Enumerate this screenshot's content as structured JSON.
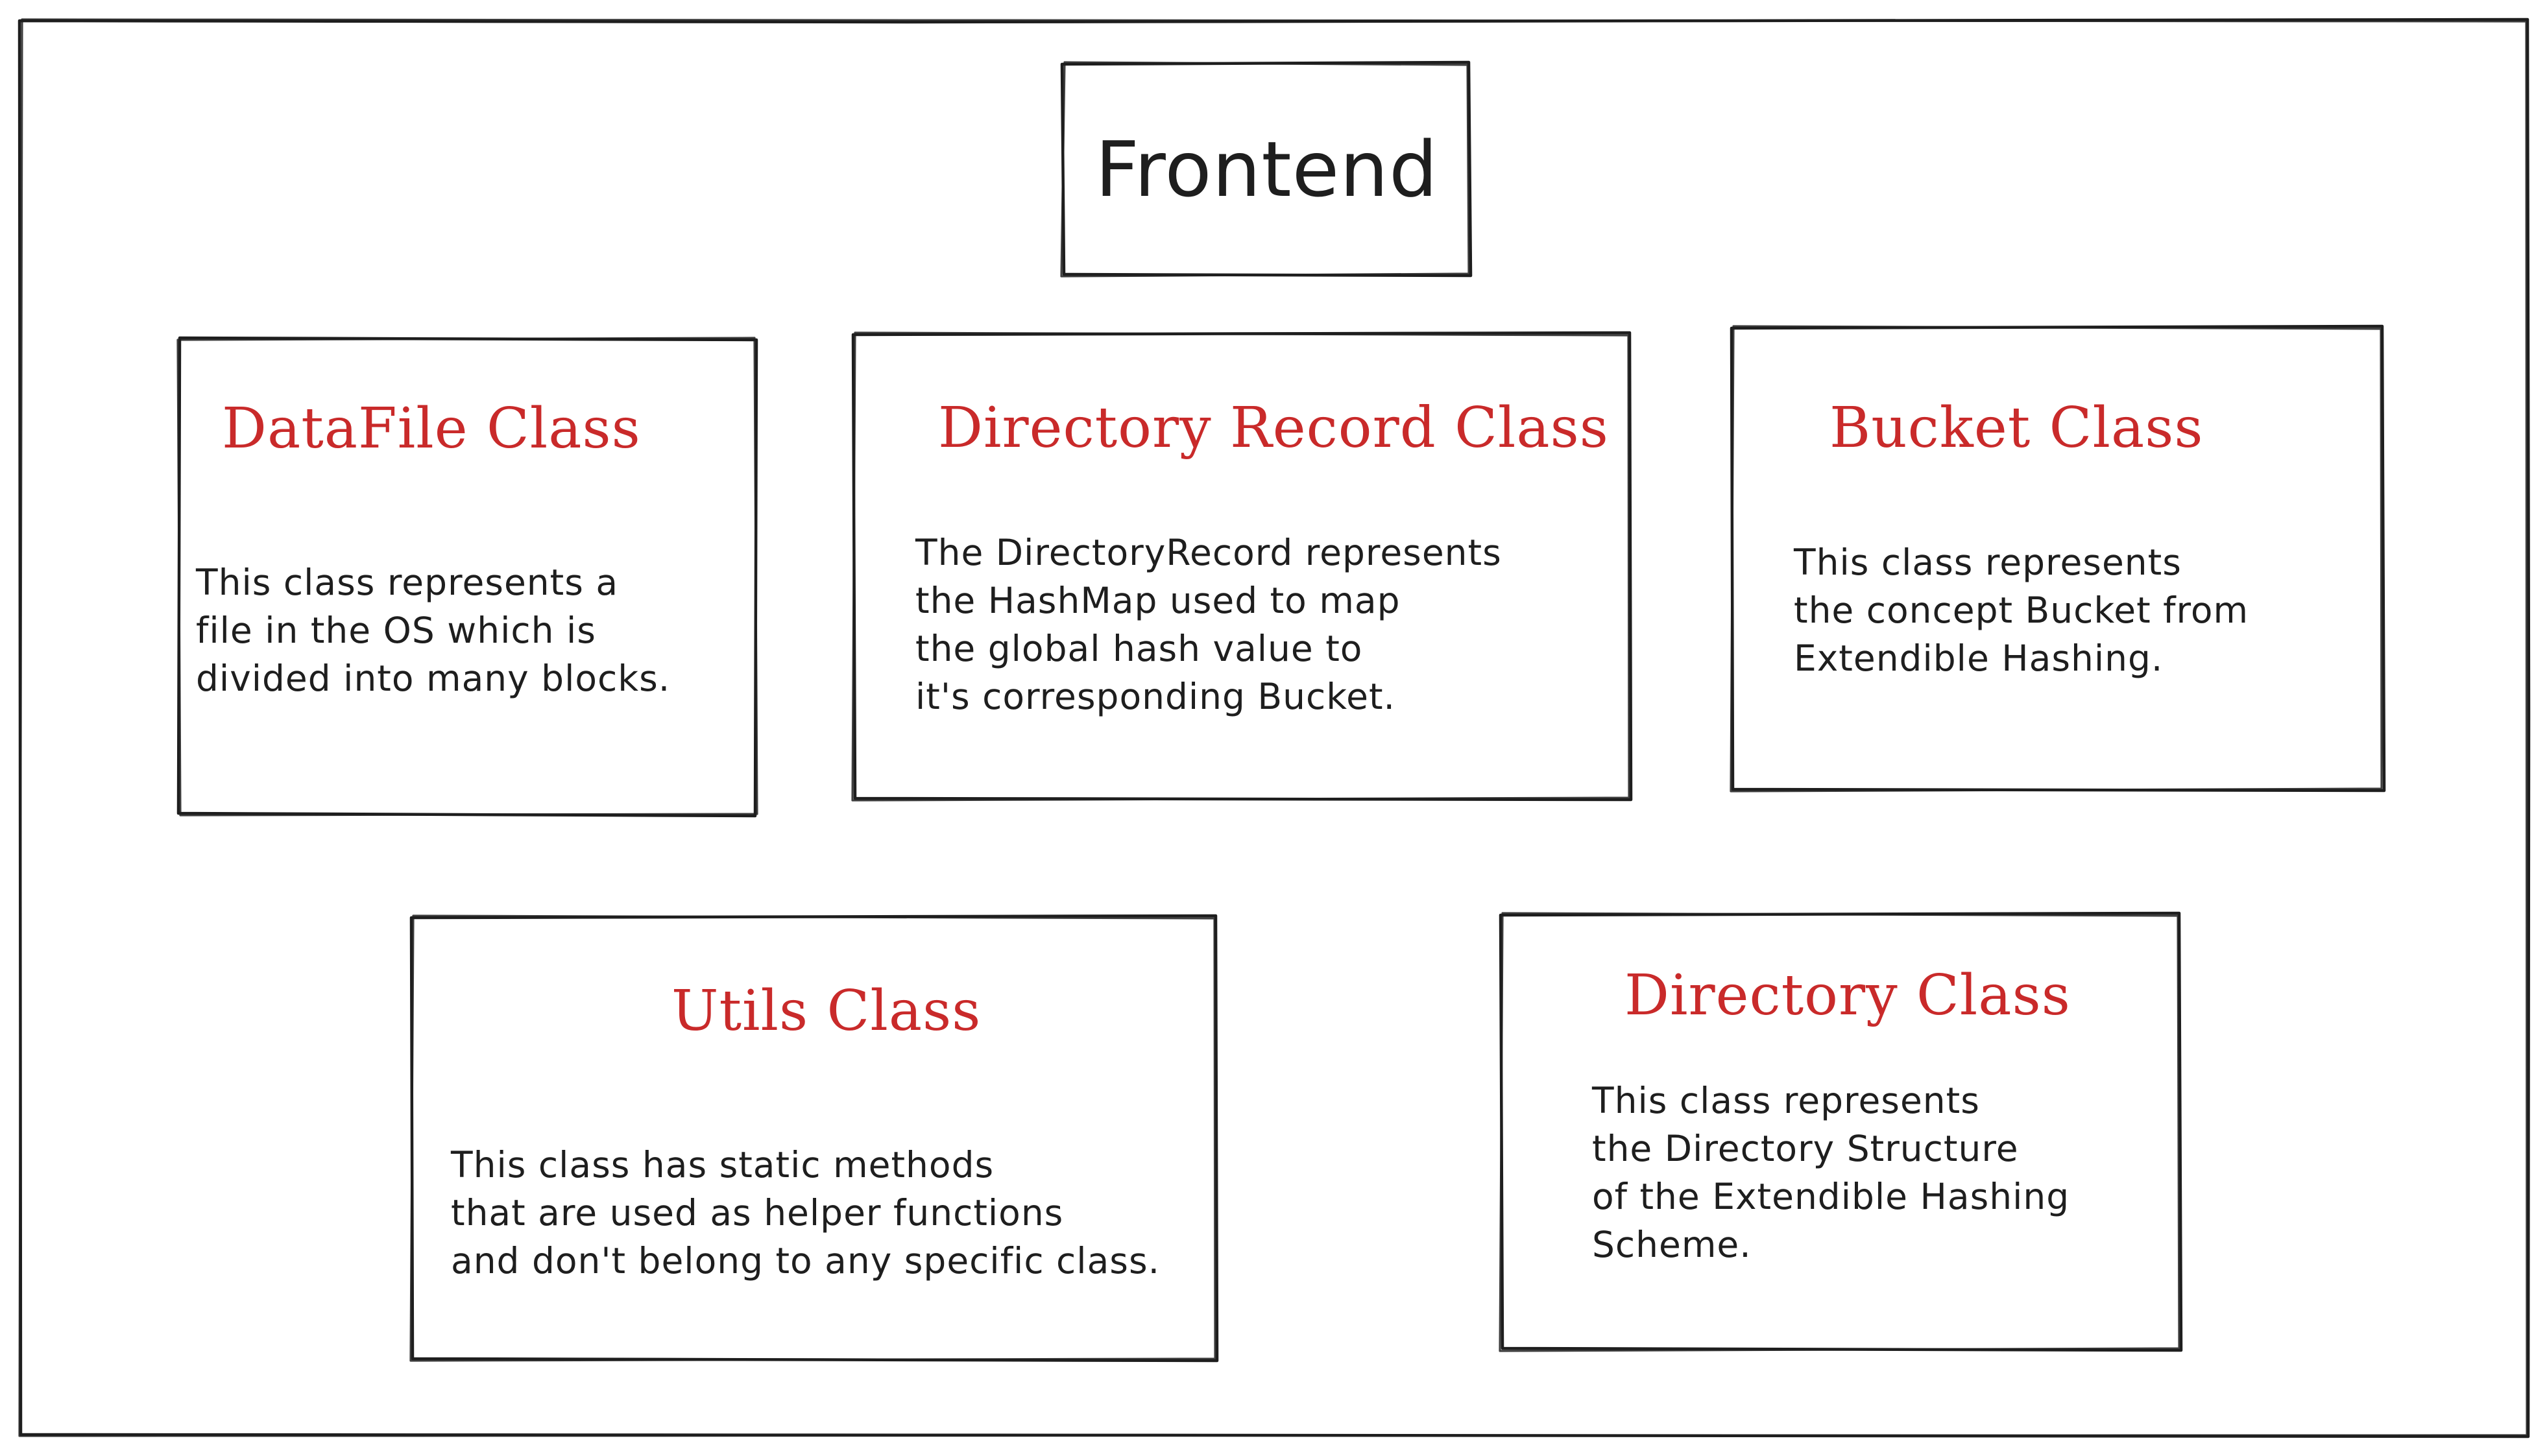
{
  "diagram": {
    "root": {
      "label": "Frontend"
    },
    "classes": [
      {
        "id": "datafile",
        "title": "DataFile Class",
        "description": [
          "This class represents a",
          "file in the OS which is",
          "divided into many blocks."
        ]
      },
      {
        "id": "directory-record",
        "title": "Directory Record Class",
        "description": [
          "The DirectoryRecord represents",
          "the HashMap used to map",
          "the global hash value to",
          "it's corresponding Bucket."
        ]
      },
      {
        "id": "bucket",
        "title": "Bucket Class",
        "description": [
          "This class represents",
          "the concept Bucket from",
          "Extendible Hashing."
        ]
      },
      {
        "id": "utils",
        "title": "Utils Class",
        "description": [
          "This class has static methods",
          "that are used as helper functions",
          "and don't belong to any specific class."
        ]
      },
      {
        "id": "directory",
        "title": "Directory Class",
        "description": [
          "This class represents",
          "the Directory Structure",
          "of the Extendible Hashing",
          "Scheme."
        ]
      }
    ],
    "colors": {
      "stroke": "#1e1e1e",
      "title_red": "#c92a2a",
      "background": "#ffffff"
    }
  }
}
